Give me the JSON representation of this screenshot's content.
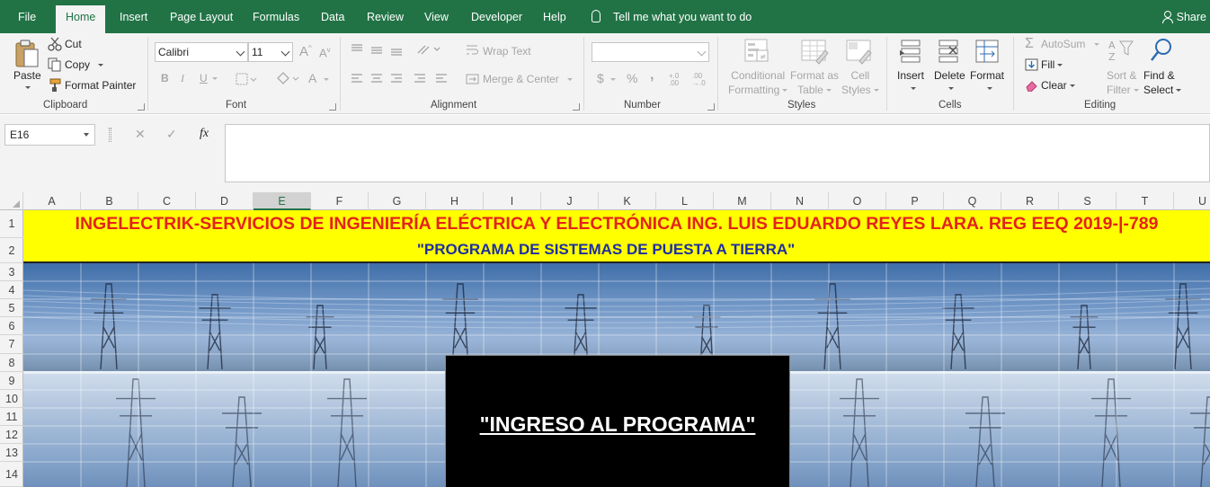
{
  "ribbon_tabs": [
    {
      "label": "File"
    },
    {
      "label": "Home",
      "active": true
    },
    {
      "label": "Insert"
    },
    {
      "label": "Page Layout"
    },
    {
      "label": "Formulas"
    },
    {
      "label": "Data"
    },
    {
      "label": "Review"
    },
    {
      "label": "View"
    },
    {
      "label": "Developer"
    },
    {
      "label": "Help"
    }
  ],
  "tell_me": "Tell me what you want to do",
  "share": "Share",
  "clipboard": {
    "paste": "Paste",
    "cut": "Cut",
    "copy": "Copy",
    "format_painter": "Format Painter",
    "group_label": "Clipboard"
  },
  "font": {
    "name": "Calibri",
    "size": "11",
    "grow": "A",
    "shrink": "A",
    "bold": "B",
    "italic": "I",
    "underline": "U",
    "font_color": "A",
    "group_label": "Font"
  },
  "alignment": {
    "wrap_text": "Wrap Text",
    "merge_center": "Merge & Center",
    "group_label": "Alignment"
  },
  "number": {
    "format": "",
    "currency": "$",
    "percent": "%",
    "comma": ",",
    "inc_decimal": "+.0 .00",
    "dec_decimal": ".00 →.0",
    "group_label": "Number"
  },
  "styles": {
    "conditional_formatting": [
      "Conditional",
      "Formatting"
    ],
    "format_as_table": [
      "Format as",
      "Table"
    ],
    "cell_styles": [
      "Cell",
      "Styles"
    ],
    "group_label": "Styles"
  },
  "cells": {
    "insert": "Insert",
    "delete": "Delete",
    "format": "Format",
    "group_label": "Cells"
  },
  "editing": {
    "autosum": "AutoSum",
    "fill": "Fill",
    "clear": "Clear",
    "sort_filter": [
      "Sort &",
      "Filter"
    ],
    "find_select": [
      "Find &",
      "Select"
    ],
    "group_label": "Editing"
  },
  "formula_bar": {
    "name_box": "E16",
    "cancel": "✕",
    "enter": "✓",
    "fx": "fx",
    "formula": ""
  },
  "sheet": {
    "columns": [
      "A",
      "B",
      "C",
      "D",
      "E",
      "F",
      "G",
      "H",
      "I",
      "J",
      "K",
      "L",
      "M",
      "N",
      "O",
      "P",
      "Q",
      "R",
      "S",
      "T",
      "U"
    ],
    "selected_column": "E",
    "rows": [
      "1",
      "2",
      "3",
      "4",
      "5",
      "6",
      "7",
      "8",
      "9",
      "10",
      "11",
      "12",
      "13",
      "14"
    ],
    "title_line1": "INGELECTRIK-SERVICIOS DE INGENIERÍA ELÉCTRICA Y ELECTRÓNICA ING. LUIS EDUARDO REYES LARA. REG EEQ 2019-|-789",
    "title_line2": "\"PROGRAMA DE SISTEMAS DE PUESTA A TIERRA\"",
    "title_line1_color": "#e5221b",
    "title_line2_color": "#1f2fa0",
    "banner_color": "#ffff00",
    "login_button": "\"INGRESO AL PROGRAMA\""
  },
  "accent_color": "#217346"
}
